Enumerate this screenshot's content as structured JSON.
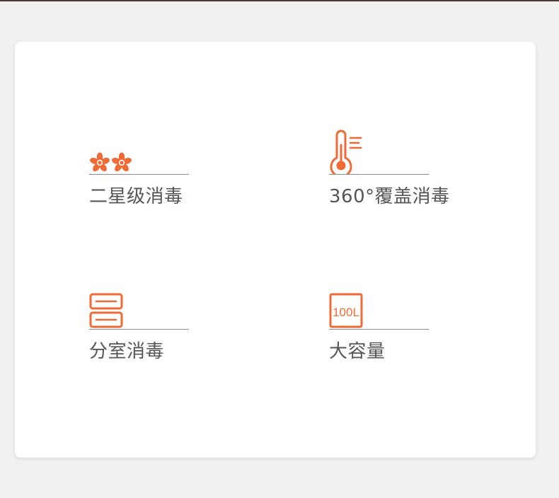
{
  "accent_color": "#f06a35",
  "features": [
    {
      "label": "二星级消毒",
      "icon": "two-stars-icon"
    },
    {
      "label": "360°覆盖消毒",
      "icon": "thermometer-icon"
    },
    {
      "label": "分室消毒",
      "icon": "two-compartment-icon"
    },
    {
      "label": "大容量",
      "icon": "capacity-100l-icon",
      "icon_text": "100L"
    }
  ]
}
